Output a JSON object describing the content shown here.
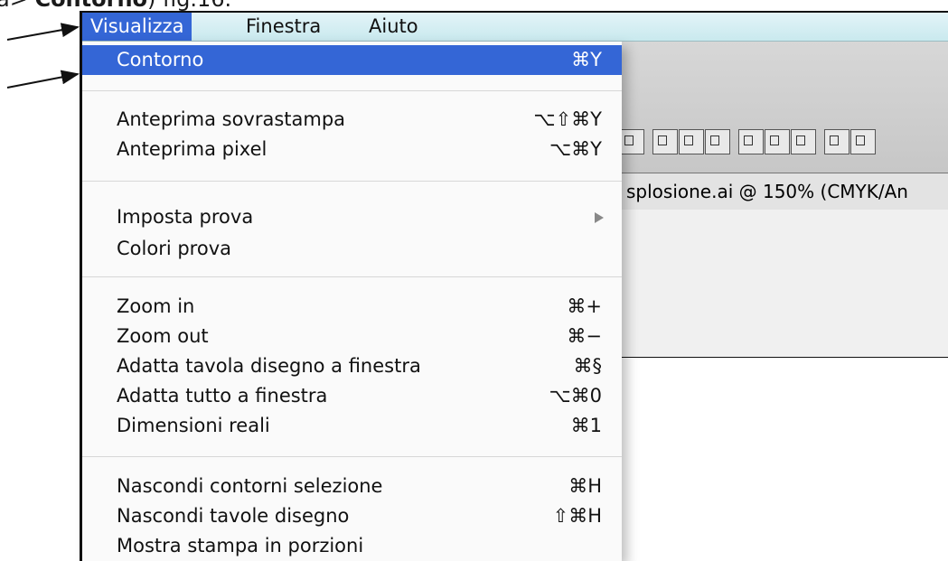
{
  "caption": {
    "prefix": "a> ",
    "bold": "Contorno",
    "suffix": ") fig.16."
  },
  "menubar": {
    "items": [
      {
        "label": "Visualizza"
      },
      {
        "label": "Finestra"
      },
      {
        "label": "Aiuto"
      }
    ]
  },
  "doc_tab": {
    "title": "splosione.ai @ 150% (CMYK/An"
  },
  "menu": {
    "items": [
      {
        "label": "Contorno",
        "shortcut": "⌘Y"
      },
      {
        "label": "Anteprima sovrastampa",
        "shortcut": "⌥⇧⌘Y"
      },
      {
        "label": "Anteprima pixel",
        "shortcut": "⌥⌘Y"
      },
      {
        "label": "Imposta prova",
        "shortcut": ""
      },
      {
        "label": "Colori prova",
        "shortcut": ""
      },
      {
        "label": "Zoom in",
        "shortcut": "⌘+"
      },
      {
        "label": "Zoom out",
        "shortcut": "⌘−"
      },
      {
        "label": "Adatta tavola disegno a finestra",
        "shortcut": "⌘§"
      },
      {
        "label": "Adatta tutto a finestra",
        "shortcut": "⌥⌘0"
      },
      {
        "label": "Dimensioni reali",
        "shortcut": "⌘1"
      },
      {
        "label": "Nascondi contorni selezione",
        "shortcut": "⌘H"
      },
      {
        "label": "Nascondi tavole disegno",
        "shortcut": "⇧⌘H"
      },
      {
        "label": "Mostra stampa in porzioni",
        "shortcut": ""
      }
    ]
  },
  "colors": {
    "highlight": "#3466d6",
    "menubar": "#c9e9ee"
  }
}
